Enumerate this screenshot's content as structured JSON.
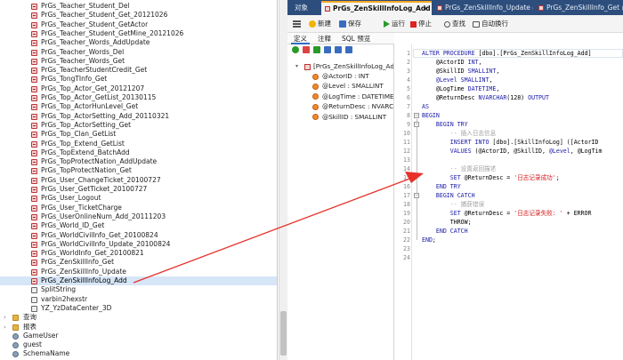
{
  "object_tree": {
    "items": [
      {
        "label": "PrGs_Teacher_Student_Del",
        "type": "proc"
      },
      {
        "label": "PrGs_Teacher_Student_Get_20121026",
        "type": "proc"
      },
      {
        "label": "PrGs_Teacher_Student_GetActor",
        "type": "proc"
      },
      {
        "label": "PrGs_Teacher_Student_GetMine_20121026",
        "type": "proc"
      },
      {
        "label": "PrGs_Teacher_Words_AddUpdate",
        "type": "proc"
      },
      {
        "label": "PrGs_Teacher_Words_Del",
        "type": "proc"
      },
      {
        "label": "PrGs_Teacher_Words_Get",
        "type": "proc"
      },
      {
        "label": "PrGs_TeacherStudentCredit_Get",
        "type": "proc"
      },
      {
        "label": "PrGs_TongTInfo_Get",
        "type": "proc"
      },
      {
        "label": "PrGs_Top_Actor_Get_20121207",
        "type": "proc"
      },
      {
        "label": "PrGs_Top_Actor_GetList_20130115",
        "type": "proc"
      },
      {
        "label": "PrGs_Top_ActorHunLevel_Get",
        "type": "proc"
      },
      {
        "label": "PrGs_Top_ActorSetting_Add_20110321",
        "type": "proc"
      },
      {
        "label": "PrGs_Top_ActorSetting_Get",
        "type": "proc"
      },
      {
        "label": "PrGs_Top_Clan_GetList",
        "type": "proc"
      },
      {
        "label": "PrGs_Top_Extend_GetList",
        "type": "proc"
      },
      {
        "label": "PrGs_TopExtend_BatchAdd",
        "type": "proc"
      },
      {
        "label": "PrGs_TopProtectNation_AddUpdate",
        "type": "proc"
      },
      {
        "label": "PrGs_TopProtectNation_Get",
        "type": "proc"
      },
      {
        "label": "PrGs_User_ChangeTicket_20100727",
        "type": "proc"
      },
      {
        "label": "PrGs_User_GetTicket_20100727",
        "type": "proc"
      },
      {
        "label": "PrGs_User_Logout",
        "type": "proc"
      },
      {
        "label": "PrGs_User_TicketCharge",
        "type": "proc"
      },
      {
        "label": "PrGs_UserOnlineNum_Add_20111203",
        "type": "proc"
      },
      {
        "label": "PrGs_World_ID_Get",
        "type": "proc"
      },
      {
        "label": "PrGs_WorldCivilInfo_Get_20100824",
        "type": "proc"
      },
      {
        "label": "PrGs_WorldCivilInfo_Update_20100824",
        "type": "proc"
      },
      {
        "label": "PrGs_WorldInfo_Get_20100821",
        "type": "proc"
      },
      {
        "label": "PrGs_ZenSkillInfo_Get",
        "type": "proc"
      },
      {
        "label": "PrGs_ZenSkillInfo_Update",
        "type": "proc"
      },
      {
        "label": "PrGs_ZenSkillInfoLog_Add",
        "type": "proc",
        "selected": true
      },
      {
        "label": "SplitString",
        "type": "func"
      },
      {
        "label": "varbin2hexstr",
        "type": "func"
      },
      {
        "label": "YZ_YzDataCenter_3D",
        "type": "func"
      },
      {
        "label": "查询",
        "type": "folder",
        "expander": "›"
      },
      {
        "label": "报表",
        "type": "folder",
        "expander": "›"
      },
      {
        "label": "GameUser",
        "type": "user"
      },
      {
        "label": "guest",
        "type": "user"
      },
      {
        "label": "SchemaName",
        "type": "user"
      }
    ]
  },
  "tabs": [
    {
      "label": "对象",
      "active": false
    },
    {
      "label": "PrGs_ZenSkillInfoLog_Add ...",
      "active": true,
      "close": "×"
    },
    {
      "label": "PrGs_ZenSkillInfo_Update @...",
      "active": false
    },
    {
      "label": "PrGs_ZenSkillInfo_Get @...",
      "active": false
    }
  ],
  "toolbar": {
    "new_label": "新建",
    "save_label": "保存",
    "run_label": "运行",
    "stop_label": "停止",
    "find_label": "查找",
    "wrap_label": "自动换行"
  },
  "sub_tabs": [
    {
      "label": "定义",
      "active": true
    },
    {
      "label": "注释",
      "active": false
    },
    {
      "label": "SQL 预览",
      "active": false
    }
  ],
  "property_tree": {
    "root": "[PrGs_ZenSkillInfoLog_Add",
    "params": [
      "@ActorID : INT",
      "@Level : SMALLINT",
      "@LogTime : DATETIME",
      "@ReturnDesc : NVARCH",
      "@SkillID : SMALLINT"
    ]
  },
  "editor": {
    "line_numbers": [
      "1",
      "2",
      "3",
      "4",
      "5",
      "6",
      "7",
      "8",
      "9",
      "10",
      "11",
      "12",
      "13",
      "14",
      "15",
      "16",
      "17",
      "18",
      "19",
      "20",
      "21",
      "22",
      "23",
      "24"
    ],
    "lines": [
      [
        {
          "t": "ALTER PROCEDURE ",
          "c": "kw"
        },
        {
          "t": "[dbo].[PrGs_ZenSkillInfoLog_Add]",
          "c": ""
        }
      ],
      [
        {
          "t": "    @ActorID ",
          "c": ""
        },
        {
          "t": "INT",
          "c": "kw"
        },
        {
          "t": ",",
          "c": ""
        }
      ],
      [
        {
          "t": "    @SkillID ",
          "c": ""
        },
        {
          "t": "SMALLINT",
          "c": "kw"
        },
        {
          "t": ",",
          "c": ""
        }
      ],
      [
        {
          "t": "    @Level ",
          "c": "kw"
        },
        {
          "t": "SMALLINT",
          "c": "kw"
        },
        {
          "t": ",",
          "c": ""
        }
      ],
      [
        {
          "t": "    @LogTime ",
          "c": ""
        },
        {
          "t": "DATETIME",
          "c": "kw"
        },
        {
          "t": ",",
          "c": ""
        }
      ],
      [
        {
          "t": "    @ReturnDesc ",
          "c": ""
        },
        {
          "t": "NVARCHAR",
          "c": "kw"
        },
        {
          "t": "(128) ",
          "c": ""
        },
        {
          "t": "OUTPUT",
          "c": "kw"
        }
      ],
      [
        {
          "t": "AS",
          "c": "kw"
        }
      ],
      [
        {
          "t": "BEGIN",
          "c": "kw"
        }
      ],
      [
        {
          "t": "    BEGIN TRY",
          "c": "kw"
        }
      ],
      [
        {
          "t": "        -- 插入日志信息",
          "c": "cm"
        }
      ],
      [
        {
          "t": "        INSERT INTO ",
          "c": "kw"
        },
        {
          "t": "[dbo].[SkillInfoLog] ([ActorID",
          "c": ""
        }
      ],
      [
        {
          "t": "        VALUES ",
          "c": "kw"
        },
        {
          "t": "(@ActorID, @SkillID, ",
          "c": ""
        },
        {
          "t": "@Level",
          "c": "kw"
        },
        {
          "t": ", @LogTim",
          "c": ""
        }
      ],
      [
        {
          "t": "",
          "c": ""
        }
      ],
      [
        {
          "t": "        -- 设置返回描述",
          "c": "cm"
        }
      ],
      [
        {
          "t": "        SET ",
          "c": "kw"
        },
        {
          "t": "@ReturnDesc = ",
          "c": ""
        },
        {
          "t": "'日志记录成功'",
          "c": "str"
        },
        {
          "t": ";",
          "c": ""
        }
      ],
      [
        {
          "t": "    END TRY",
          "c": "kw"
        }
      ],
      [
        {
          "t": "    BEGIN CATCH",
          "c": "kw"
        }
      ],
      [
        {
          "t": "        -- 捕获错误",
          "c": "cm"
        }
      ],
      [
        {
          "t": "        SET ",
          "c": "kw"
        },
        {
          "t": "@ReturnDesc = ",
          "c": ""
        },
        {
          "t": "'日志记录失败: '",
          "c": "str"
        },
        {
          "t": " + ERROR",
          "c": ""
        }
      ],
      [
        {
          "t": "        THROW;",
          "c": ""
        }
      ],
      [
        {
          "t": "    END CATCH",
          "c": "kw"
        }
      ],
      [
        {
          "t": "END",
          "c": "kw"
        },
        {
          "t": ";",
          "c": ""
        }
      ],
      [
        {
          "t": "",
          "c": ""
        }
      ],
      [
        {
          "t": "",
          "c": ""
        }
      ]
    ]
  },
  "colors": {
    "tab_strip": "#2d4e7c",
    "active_tab_accent": "#f5a623",
    "arrow": "#e8302a",
    "keyword": "#1a1aa6",
    "string": "#d41a1a"
  }
}
